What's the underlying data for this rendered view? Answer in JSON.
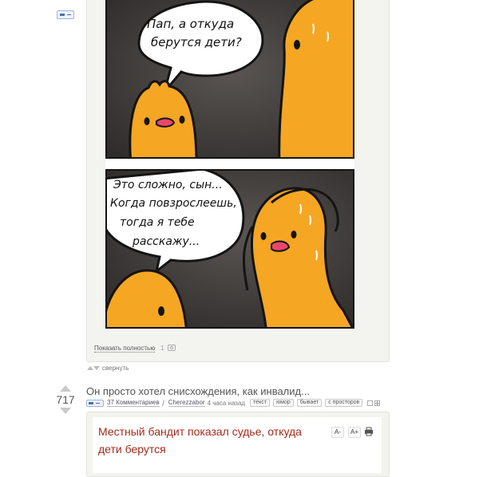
{
  "comic": {
    "panel1_bubble": [
      "Пап, а откуда",
      "берутся дети?"
    ],
    "panel2_bubble": [
      "Это сложно, сын...",
      "Когда повзрослеешь,",
      "тогда я тебе",
      "расскажу..."
    ],
    "colors": {
      "background": "#3d3a38",
      "chick": "#f5a623",
      "outline": "#141414"
    }
  },
  "story1": {
    "show_full_label": "Показать полностью",
    "images_count": "1",
    "collapse_label": "свернуть"
  },
  "story2": {
    "rating": "717",
    "title": "Он просто хотел снисхождения, как инвалид...",
    "comments": "37 Комментариев",
    "author": "Cherezzabor",
    "time": "4 часа назад",
    "tags": [
      "текст",
      "юмор",
      "бывает",
      "с просторов"
    ],
    "article": {
      "title": "Местный бандит показал судье, откуда дети берутся",
      "font_decrease": "A-",
      "font_increase": "A+"
    }
  }
}
